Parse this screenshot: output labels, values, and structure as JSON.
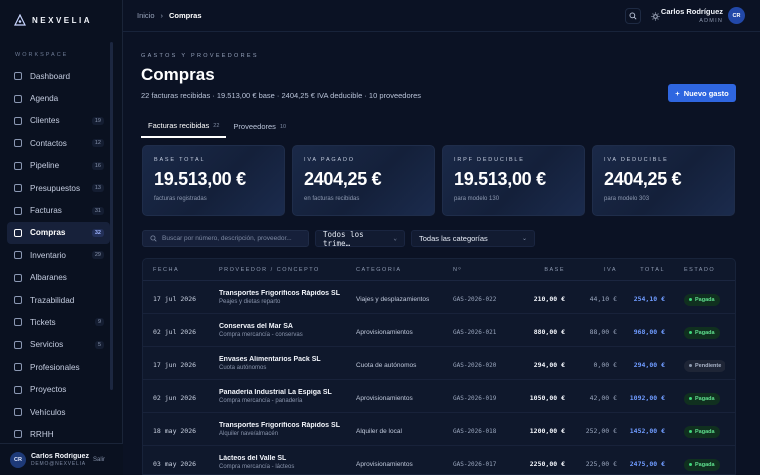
{
  "app": {
    "name": "NEXVELIA"
  },
  "sidebar": {
    "section": "WORKSPACE",
    "items": [
      {
        "label": "Dashboard",
        "count": "",
        "icon": "grid-icon",
        "active": false
      },
      {
        "label": "Agenda",
        "count": "",
        "icon": "calendar-icon",
        "active": false
      },
      {
        "label": "Clientes",
        "count": "19",
        "icon": "user-icon",
        "active": false
      },
      {
        "label": "Contactos",
        "count": "12",
        "icon": "contacts-icon",
        "active": false
      },
      {
        "label": "Pipeline",
        "count": "16",
        "icon": "pipeline-icon",
        "active": false
      },
      {
        "label": "Presupuestos",
        "count": "13",
        "icon": "document-icon",
        "active": false
      },
      {
        "label": "Facturas",
        "count": "31",
        "icon": "invoice-icon",
        "active": false
      },
      {
        "label": "Compras",
        "count": "32",
        "icon": "truck-icon",
        "active": true
      },
      {
        "label": "Inventario",
        "count": "29",
        "icon": "box-icon",
        "active": false
      },
      {
        "label": "Albaranes",
        "count": "",
        "icon": "delivery-icon",
        "active": false
      },
      {
        "label": "Trazabilidad",
        "count": "",
        "icon": "link-icon",
        "active": false
      },
      {
        "label": "Tickets",
        "count": "9",
        "icon": "bell-icon",
        "active": false
      },
      {
        "label": "Servicios",
        "count": "5",
        "icon": "tag-icon",
        "active": false
      },
      {
        "label": "Profesionales",
        "count": "",
        "icon": "person-icon",
        "active": false
      },
      {
        "label": "Proyectos",
        "count": "",
        "icon": "project-icon",
        "active": false
      },
      {
        "label": "Vehículos",
        "count": "",
        "icon": "car-icon",
        "active": false
      },
      {
        "label": "RRHH",
        "count": "",
        "icon": "people-icon",
        "active": false
      }
    ],
    "user": {
      "initials": "CR",
      "name": "Carlos Rodríguez",
      "email": "DEMO@NEXVELIA",
      "logout": "Salir"
    }
  },
  "topbar": {
    "breadcrumb": [
      "Inicio",
      "Compras"
    ],
    "user": {
      "name": "Carlos Rodríguez",
      "role": "ADMIN",
      "initials": "CR"
    },
    "icons": [
      "search-icon",
      "sun-icon"
    ]
  },
  "header": {
    "eyebrow": "GASTOS Y PROVEEDORES",
    "title": "Compras",
    "summary": "22 facturas recibidas · 19.513,00 € base · 2404,25 € IVA deducible · 10 proveedores",
    "new_button": "Nuevo gasto"
  },
  "tabs": [
    {
      "label": "Facturas recibidas",
      "count": "22",
      "active": true
    },
    {
      "label": "Proveedores",
      "count": "10",
      "active": false
    }
  ],
  "cards": [
    {
      "label": "BASE TOTAL",
      "value": "19.513,00 €",
      "sub": "facturas registradas"
    },
    {
      "label": "IVA PAGADO",
      "value": "2404,25 €",
      "sub": "en facturas recibidas"
    },
    {
      "label": "IRPF DEDUCIBLE",
      "value": "19.513,00 €",
      "sub": "para modelo 130"
    },
    {
      "label": "IVA DEDUCIBLE",
      "value": "2404,25 €",
      "sub": "para modelo 303"
    }
  ],
  "filters": {
    "search_placeholder": "Buscar por número, descripción, proveedor...",
    "period": "Todos los trime…",
    "category": "Todas las categorías"
  },
  "table": {
    "headers": [
      "FECHA",
      "PROVEEDOR / CONCEPTO",
      "CATEGORÍA",
      "Nº",
      "BASE",
      "IVA",
      "TOTAL",
      "ESTADO"
    ],
    "rows": [
      {
        "fecha": "17 jul 2026",
        "proveedor": "Transportes Frigoríficos Rápidos SL",
        "concepto": "Peajes y dietas reparto",
        "categoria": "Viajes y desplazamientos",
        "numero": "GAS-2026-022",
        "base": "210,00 €",
        "iva": "44,10 €",
        "total": "254,10 €",
        "estado": "Pagada",
        "status": "pagada"
      },
      {
        "fecha": "02 jul 2026",
        "proveedor": "Conservas del Mar SA",
        "concepto": "Compra mercancía - conservas",
        "categoria": "Aprovisionamientos",
        "numero": "GAS-2026-021",
        "base": "880,00 €",
        "iva": "88,00 €",
        "total": "968,00 €",
        "estado": "Pagada",
        "status": "pagada"
      },
      {
        "fecha": "17 jun 2026",
        "proveedor": "Envases Alimentarios Pack SL",
        "concepto": "Cuota autónomos",
        "categoria": "Cuota de autónomos",
        "numero": "GAS-2026-020",
        "base": "294,00 €",
        "iva": "0,00 €",
        "total": "294,00 €",
        "estado": "Pendiente",
        "status": "pendiente"
      },
      {
        "fecha": "02 jun 2026",
        "proveedor": "Panadería Industrial La Espiga SL",
        "concepto": "Compra mercancía - panadería",
        "categoria": "Aprovisionamientos",
        "numero": "GAS-2026-019",
        "base": "1050,00 €",
        "iva": "42,00 €",
        "total": "1092,00 €",
        "estado": "Pagada",
        "status": "pagada"
      },
      {
        "fecha": "18 may 2026",
        "proveedor": "Transportes Frigoríficos Rápidos SL",
        "concepto": "Alquiler nave/almacén",
        "categoria": "Alquiler de local",
        "numero": "GAS-2026-018",
        "base": "1200,00 €",
        "iva": "252,00 €",
        "total": "1452,00 €",
        "estado": "Pagada",
        "status": "pagada"
      },
      {
        "fecha": "03 may 2026",
        "proveedor": "Lácteos del Valle SL",
        "concepto": "Compra mercancía - lácteos",
        "categoria": "Aprovisionamientos",
        "numero": "GAS-2026-017",
        "base": "2250,00 €",
        "iva": "225,00 €",
        "total": "2475,00 €",
        "estado": "Pagada",
        "status": "pagada"
      }
    ]
  },
  "colors": {
    "accent": "#2f66e0",
    "paid": "#3fd77a",
    "total": "#6f9bff"
  }
}
